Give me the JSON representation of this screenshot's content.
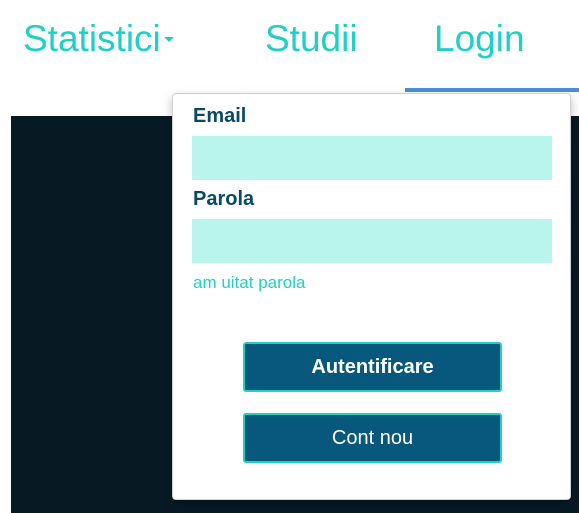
{
  "nav": {
    "statistici_label": "Statistici",
    "studii_label": "Studii",
    "login_label": "Login"
  },
  "login_form": {
    "email_label": "Email",
    "email_value": "",
    "password_label": "Parola",
    "password_value": "",
    "forgot_password_label": "am uitat parola",
    "login_button_label": "Autentificare",
    "register_button_label": "Cont nou"
  },
  "colors": {
    "accent": "#1fd1c4",
    "button_bg": "#07587c",
    "label_text": "#0b4a66",
    "input_bg": "#b9f5ec",
    "dark_background": "#071a24",
    "active_tab_underline": "#4a8fd6"
  },
  "icons": {
    "dropdown_caret": "caret-down-icon"
  }
}
